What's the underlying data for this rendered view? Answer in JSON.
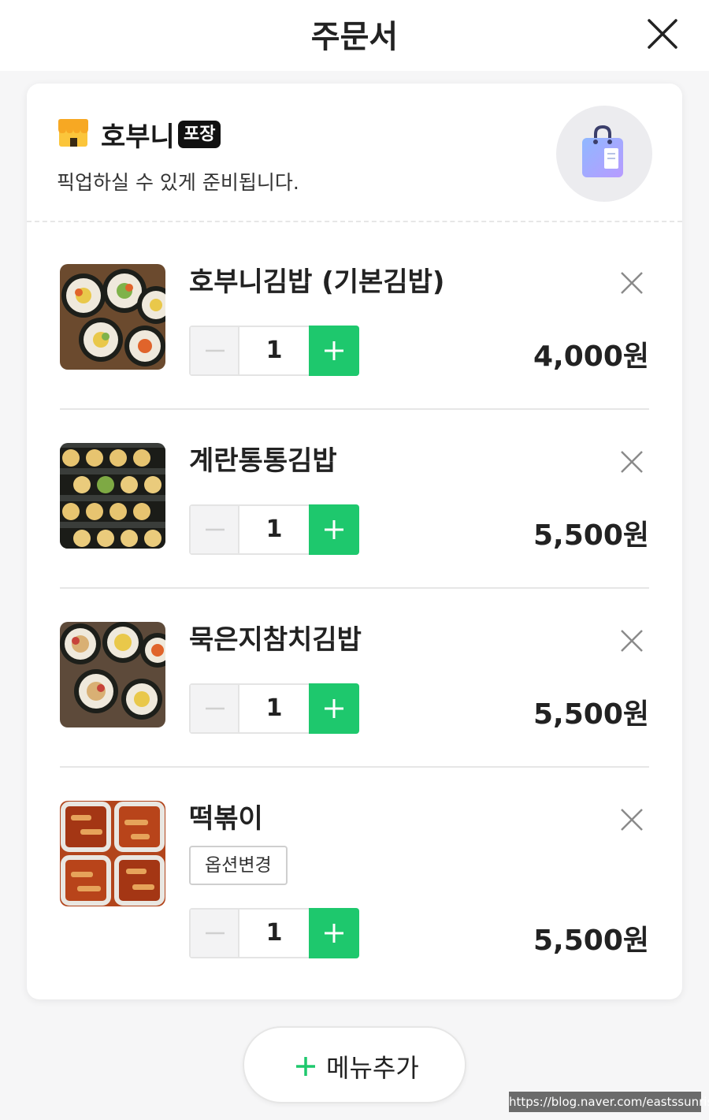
{
  "header": {
    "title": "주문서"
  },
  "store": {
    "name": "호부니",
    "badge": "포장",
    "description": "픽업하실 수 있게 준비됩니다."
  },
  "items": [
    {
      "name": "호부니김밥 (기본김밥)",
      "quantity": "1",
      "price": "4,000원"
    },
    {
      "name": "계란통통김밥",
      "quantity": "1",
      "price": "5,500원"
    },
    {
      "name": "묵은지참치김밥",
      "quantity": "1",
      "price": "5,500원"
    },
    {
      "name": "떡볶이",
      "option_label": "옵션변경",
      "quantity": "1",
      "price": "5,500원"
    }
  ],
  "add_menu": {
    "label": "메뉴추가"
  },
  "watermark": "https://blog.naver.com/eastssunrise",
  "colors": {
    "accent": "#1ec86d",
    "badge_bg": "#111111",
    "store_icon": "#f7a823"
  }
}
